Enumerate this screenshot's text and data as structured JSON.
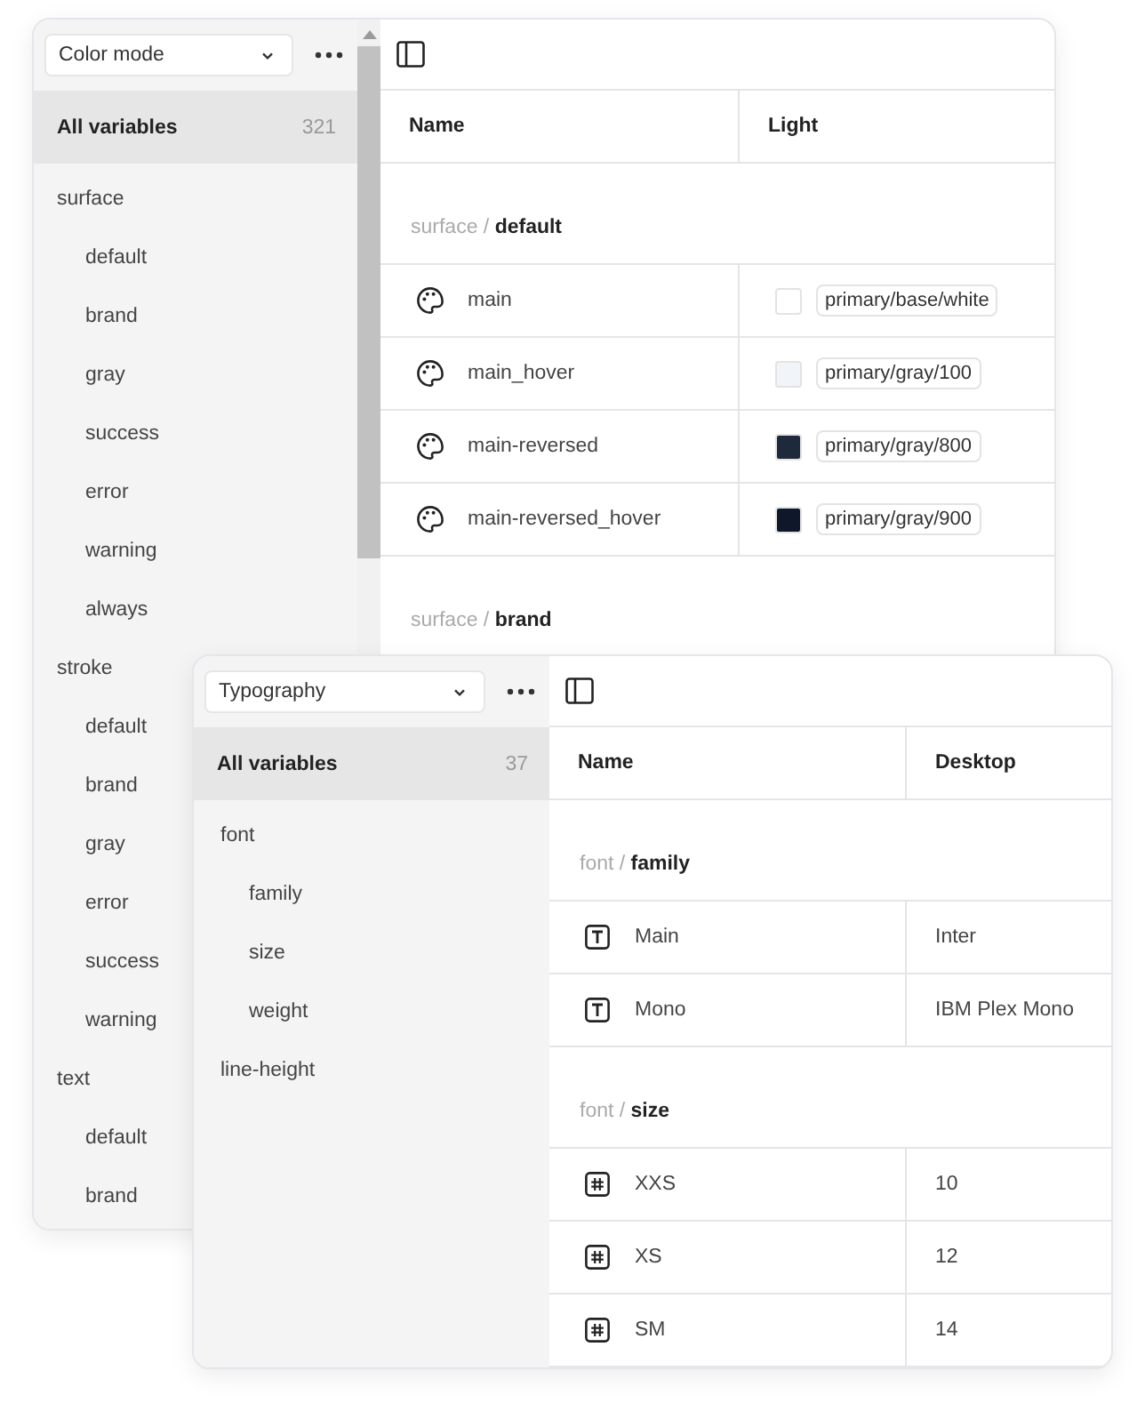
{
  "windows": [
    {
      "collection": "Color mode",
      "all_variables": {
        "label": "All variables",
        "count": "321",
        "selected": true
      },
      "sidebar": {
        "items": [
          {
            "label": "surface",
            "selected": false,
            "children": [
              {
                "label": "default",
                "selected": false
              },
              {
                "label": "brand",
                "selected": false
              },
              {
                "label": "gray",
                "selected": false
              },
              {
                "label": "success",
                "selected": false
              },
              {
                "label": "error",
                "selected": false
              },
              {
                "label": "warning",
                "selected": false
              },
              {
                "label": "always",
                "selected": false
              }
            ]
          },
          {
            "label": "stroke",
            "selected": false,
            "children": [
              {
                "label": "default",
                "selected": false
              },
              {
                "label": "brand",
                "selected": false
              },
              {
                "label": "gray",
                "selected": false
              },
              {
                "label": "error",
                "selected": false
              },
              {
                "label": "success",
                "selected": false
              },
              {
                "label": "warning",
                "selected": false
              }
            ]
          },
          {
            "label": "text",
            "selected": false,
            "children": [
              {
                "label": "default",
                "selected": false
              },
              {
                "label": "brand",
                "selected": false
              }
            ]
          }
        ]
      },
      "table": {
        "columns": [
          "Name",
          "Light"
        ],
        "groups": [
          {
            "label": "surface / **default**",
            "rows": [
              {
                "kind": "color",
                "name": "main",
                "color": "#ffffff",
                "value": "primary/base/white"
              },
              {
                "kind": "color",
                "name": "main_hover",
                "color": "#f1f5f9",
                "value": "primary/gray/100"
              },
              {
                "kind": "color",
                "name": "main-reversed",
                "color": "#1e293b",
                "value": "primary/gray/800"
              },
              {
                "kind": "color",
                "name": "main-reversed_hover",
                "color": "#0f172a",
                "value": "primary/gray/900"
              }
            ]
          },
          {
            "label": "surface / **brand**"
          }
        ]
      }
    },
    {
      "collection": "Typography",
      "all_variables": {
        "label": "All variables",
        "count": "37",
        "selected": true
      },
      "sidebar": {
        "items": [
          {
            "label": "font",
            "selected": false,
            "children": [
              {
                "label": "family",
                "selected": false
              },
              {
                "label": "size",
                "selected": false
              },
              {
                "label": "weight",
                "selected": false
              }
            ]
          },
          {
            "label": "line-height",
            "selected": false
          }
        ]
      },
      "table": {
        "columns": [
          "Name",
          "Desktop"
        ],
        "groups": [
          {
            "label": "font / **family**",
            "rows": [
              {
                "kind": "text",
                "name": "Main",
                "value": "Inter"
              },
              {
                "kind": "text",
                "name": "Mono",
                "value": "IBM Plex Mono"
              }
            ]
          },
          {
            "label": "font / **size**",
            "rows": [
              {
                "kind": "number",
                "name": "XXS",
                "value": "10"
              },
              {
                "kind": "number",
                "name": "XS",
                "value": "12"
              },
              {
                "kind": "number",
                "name": "SM",
                "value": "14"
              }
            ]
          }
        ]
      }
    }
  ]
}
